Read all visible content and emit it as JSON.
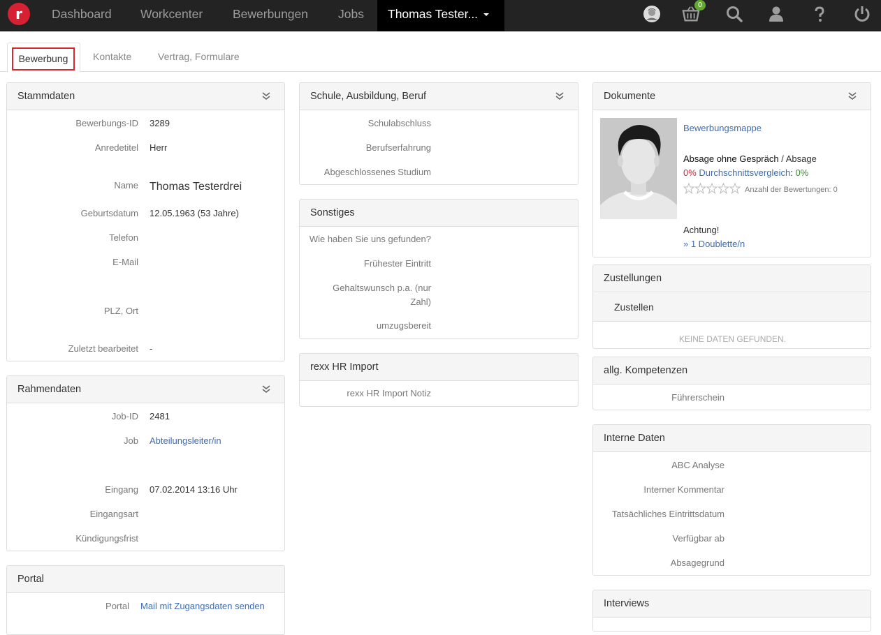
{
  "nav": {
    "logo": "r",
    "items": [
      "Dashboard",
      "Workcenter",
      "Bewerbungen",
      "Jobs"
    ],
    "active": "Thomas Tester...",
    "cart_count": "0"
  },
  "tabs": [
    "Bewerbung",
    "Kontakte",
    "Vertrag, Formulare"
  ],
  "stammdaten": {
    "title": "Stammdaten",
    "rows": [
      {
        "label": "Bewerbungs-ID",
        "value": "3289"
      },
      {
        "label": "Anredetitel",
        "value": "Herr"
      },
      {
        "label": "Name",
        "value": "Thomas Testerdrei"
      },
      {
        "label": "Geburtsdatum",
        "value": "12.05.1963 (53 Jahre)"
      },
      {
        "label": "Telefon",
        "value": ""
      },
      {
        "label": "E-Mail",
        "value": ""
      },
      {
        "label": "PLZ, Ort",
        "value": ""
      },
      {
        "label": "Zuletzt bearbeitet",
        "value": "-"
      }
    ]
  },
  "rahmendaten": {
    "title": "Rahmendaten",
    "rows": [
      {
        "label": "Job-ID",
        "value": "2481"
      },
      {
        "label": "Job",
        "value": "Abteilungsleiter/in"
      },
      {
        "label": "Eingang",
        "value": "07.02.2014 13:16 Uhr"
      },
      {
        "label": "Eingangsart",
        "value": ""
      },
      {
        "label": "Kündigungsfrist",
        "value": ""
      }
    ]
  },
  "portal": {
    "title": "Portal",
    "label": "Portal",
    "link": "Mail mit Zugangsdaten senden"
  },
  "schule": {
    "title": "Schule, Ausbildung, Beruf",
    "rows": [
      "Schulabschluss",
      "Berufserfahrung",
      "Abgeschlossenes Studium"
    ]
  },
  "sonstiges": {
    "title": "Sonstiges",
    "rows": [
      "Wie haben Sie uns gefunden?",
      "Frühester Eintritt",
      "Gehaltswunsch p.a. (nur",
      "Zahl)",
      "umzugsbereit"
    ]
  },
  "rexx": {
    "title": "rexx HR Import",
    "rows": [
      "rexx HR Import Notiz"
    ]
  },
  "dokumente": {
    "title": "Dokumente",
    "mappe": "Bewerbungsmappe",
    "absage_bold": "Absage ohne Gespräch",
    "absage_sep": " / ",
    "absage": "Absage",
    "pct1": "0%",
    "vergleich": "Durchschnittsvergleich",
    "colon": ":",
    "pct2": "0%",
    "rating_label": "Anzahl der Bewertungen: 0",
    "achtung": "Achtung!",
    "doublette": "» 1 Doublette/n"
  },
  "zustellungen": {
    "title": "Zustellungen",
    "sub": "Zustellen",
    "empty": "KEINE DATEN GEFUNDEN."
  },
  "kompetenzen": {
    "title": "allg. Kompetenzen",
    "rows": [
      "Führerschein"
    ]
  },
  "interne": {
    "title": "Interne Daten",
    "rows": [
      "ABC Analyse",
      "Interner Kommentar",
      "Tatsächliches Eintrittsdatum",
      "Verfügbar ab",
      "Absagegrund"
    ]
  },
  "interviews": {
    "title": "Interviews"
  }
}
